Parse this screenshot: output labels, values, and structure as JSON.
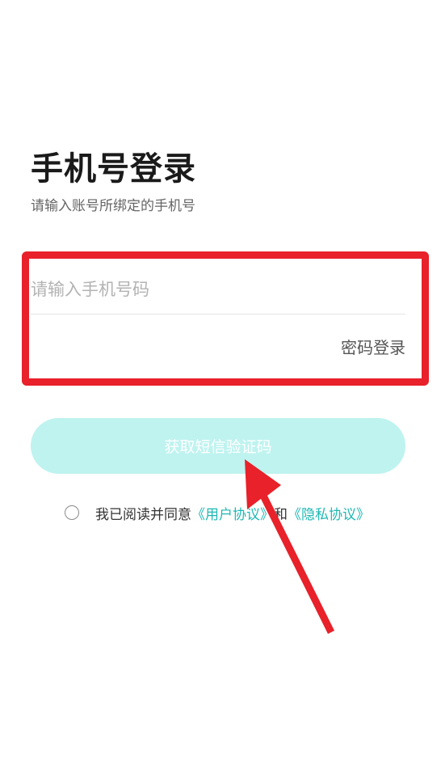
{
  "header": {
    "title": "手机号登录",
    "subtitle": "请输入账号所绑定的手机号"
  },
  "form": {
    "phone_placeholder": "请输入手机号码",
    "phone_value": "",
    "password_login_label": "密码登录",
    "sms_button_label": "获取短信验证码"
  },
  "agreement": {
    "prefix": "我已阅读并同意",
    "user_agreement": "《用户协议》",
    "conjunction": "和",
    "privacy_agreement": "《隐私协议》"
  },
  "colors": {
    "highlight": "#e8212a",
    "button_bg": "#bff3ef",
    "link": "#1fb8b3"
  }
}
